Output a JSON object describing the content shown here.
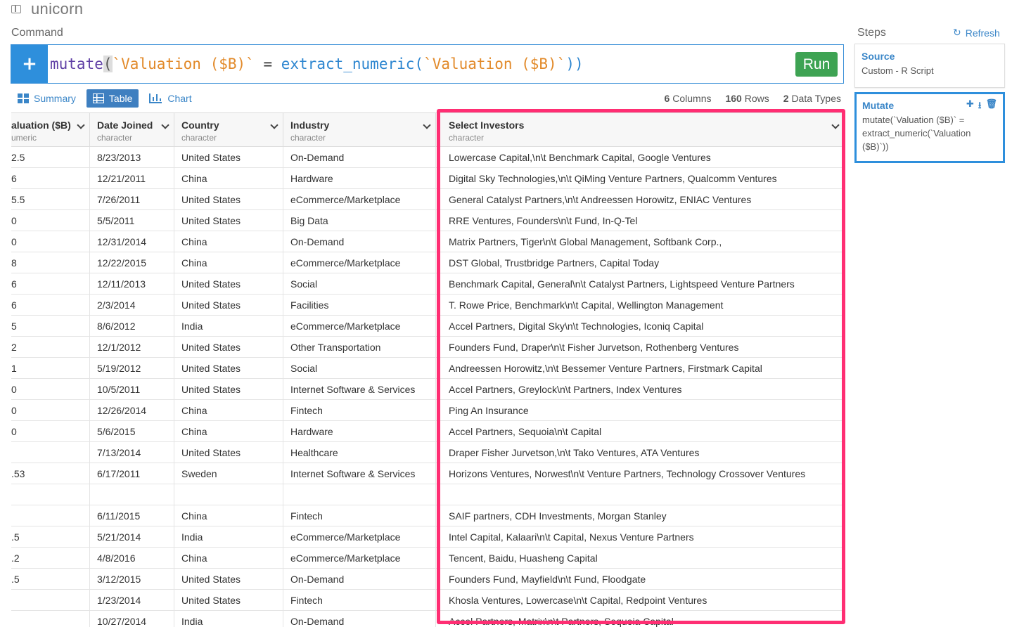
{
  "app": {
    "title": "unicorn"
  },
  "command": {
    "label": "Command",
    "add_symbol": "+",
    "code": {
      "fn": "mutate",
      "open_paren": "(",
      "target": "`Valuation ($B)`",
      "eq": " = ",
      "fn2": "extract_numeric(",
      "arg": "`Valuation ($B)`",
      "close": "))"
    },
    "run_label": "Run"
  },
  "view_tabs": [
    {
      "label": "Summary",
      "icon": "summary-icon",
      "active": false
    },
    {
      "label": "Table",
      "icon": "table-icon",
      "active": true
    },
    {
      "label": "Chart",
      "icon": "chart-icon",
      "active": false
    }
  ],
  "stats": {
    "columns_count": "6",
    "columns_label": "Columns",
    "rows_count": "160",
    "rows_label": "Rows",
    "types_count": "2",
    "types_label": "Data Types"
  },
  "table": {
    "columns": [
      {
        "name": "aluation ($B)",
        "type": "umeric"
      },
      {
        "name": "Date Joined",
        "type": "character"
      },
      {
        "name": "Country",
        "type": "character"
      },
      {
        "name": "Industry",
        "type": "character"
      },
      {
        "name": "Select Investors",
        "type": "character"
      }
    ],
    "rows": [
      [
        "2.5",
        "8/23/2013",
        "United States",
        "On-Demand",
        "Lowercase Capital,\\n\\t  Benchmark Capital, Google Ventures"
      ],
      [
        "6",
        "12/21/2011",
        "China",
        "Hardware",
        "Digital Sky Technologies,\\n\\t  QiMing Venture Partners, Qualcomm Ventures"
      ],
      [
        "5.5",
        "7/26/2011",
        "United States",
        "eCommerce/Marketplace",
        "General Catalyst Partners,\\n\\t  Andreessen Horowitz, ENIAC Ventures"
      ],
      [
        "0",
        "5/5/2011",
        "United States",
        "Big Data",
        "RRE Ventures, Founders\\n\\t  Fund, In-Q-Tel"
      ],
      [
        "0",
        "12/31/2014",
        "China",
        "On-Demand",
        "Matrix Partners, Tiger\\n\\t  Global Management, Softbank Corp.,"
      ],
      [
        "8",
        "12/22/2015",
        "China",
        "eCommerce/Marketplace",
        "DST Global, Trustbridge Partners, Capital Today"
      ],
      [
        "6",
        "12/11/2013",
        "United States",
        "Social",
        "Benchmark Capital, General\\n\\t  Catalyst Partners, Lightspeed Venture Partners"
      ],
      [
        "6",
        "2/3/2014",
        "United States",
        "Facilities",
        "T. Rowe Price, Benchmark\\n\\t  Capital, Wellington Management"
      ],
      [
        "5",
        "8/6/2012",
        "India",
        "eCommerce/Marketplace",
        "Accel Partners, Digital Sky\\n\\t  Technologies, Iconiq Capital"
      ],
      [
        "2",
        "12/1/2012",
        "United States",
        "Other Transportation",
        "Founders Fund, Draper\\n\\t  Fisher Jurvetson, Rothenberg Ventures"
      ],
      [
        "1",
        "5/19/2012",
        "United States",
        "Social",
        "Andreessen Horowitz,\\n\\t  Bessemer Venture Partners, Firstmark Capital"
      ],
      [
        "0",
        "10/5/2011",
        "United States",
        "Internet Software & Services",
        "Accel Partners, Greylock\\n\\t  Partners, Index Ventures"
      ],
      [
        "0",
        "12/26/2014",
        "China",
        "Fintech",
        "Ping An Insurance"
      ],
      [
        "0",
        "5/6/2015",
        "China",
        "Hardware",
        "Accel Partners, Sequoia\\n\\t  Capital"
      ],
      [
        "",
        "7/13/2014",
        "United States",
        "Healthcare",
        "Draper Fisher Jurvetson,\\n\\t  Tako Ventures, ATA Ventures"
      ],
      [
        ".53",
        "6/17/2011",
        "Sweden",
        "Internet Software & Services",
        "Horizons Ventures, Norwest\\n\\t  Venture Partners, Technology Crossover Ventures"
      ],
      [
        "",
        "",
        "",
        "",
        ""
      ],
      [
        "",
        "6/11/2015",
        "China",
        "Fintech",
        "SAIF partners, CDH Investments, Morgan Stanley"
      ],
      [
        ".5",
        "5/21/2014",
        "India",
        "eCommerce/Marketplace",
        "Intel Capital, Kalaari\\n\\t  Capital, Nexus Venture Partners"
      ],
      [
        ".2",
        "4/8/2016",
        "China",
        "eCommerce/Marketplace",
        "Tencent, Baidu, Huasheng Capital"
      ],
      [
        ".5",
        "3/12/2015",
        "United States",
        "On-Demand",
        "Founders Fund, Mayfield\\n\\t  Fund, Floodgate"
      ],
      [
        "",
        "1/23/2014",
        "United States",
        "Fintech",
        "Khosla Ventures, Lowercase\\n\\t  Capital, Redpoint Ventures"
      ],
      [
        "",
        "10/27/2014",
        "India",
        "On-Demand",
        "Accel Partners, Matrix\\n\\t  Partners, Sequoia Capital"
      ]
    ]
  },
  "steps": {
    "label": "Steps",
    "refresh_label": "Refresh",
    "items": [
      {
        "name": "Source",
        "desc": "Custom - R Script"
      },
      {
        "name": "Mutate",
        "desc": "mutate(`Valuation ($B)` = extract_numeric(`Valuation ($B)`))"
      }
    ]
  },
  "colors": {
    "accent": "#2e8fdc",
    "run_button": "#3ea353",
    "highlight": "#ff2e73"
  }
}
